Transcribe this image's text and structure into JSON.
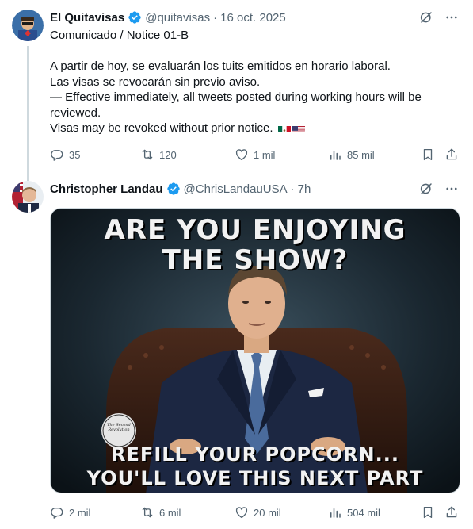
{
  "tweets": [
    {
      "author": {
        "name": "El Quitavisas",
        "handle": "@quitavisas",
        "verified": true
      },
      "date": "16 oct. 2025",
      "title": "Comunicado / Notice 01-B",
      "paragraph": [
        "A partir de hoy, se evaluarán los tuits emitidos en horario laboral.",
        "Las visas se revocarán sin previo aviso.",
        "— Effective immediately, all tweets posted during working hours will be",
        "reviewed.",
        "Visas may be revoked without prior notice."
      ],
      "flags": [
        "mexico-flag",
        "usa-flag"
      ],
      "stats": {
        "replies": "35",
        "reposts": "120",
        "likes": "1 mil",
        "views": "85 mil"
      }
    },
    {
      "author": {
        "name": "Christopher Landau",
        "handle": "@ChrisLandauUSA",
        "verified": true
      },
      "date": "7h",
      "media": {
        "top_line1": "ARE YOU ENJOYING",
        "top_line2": "THE SHOW?",
        "bottom_line1": "REFILL YOUR POPCORN...",
        "bottom_line2": "YOU'LL LOVE THIS NEXT PART",
        "watermark": "The Second Revolution"
      },
      "stats": {
        "replies": "2 mil",
        "reposts": "6 mil",
        "likes": "20 mil",
        "views": "504 mil"
      }
    }
  ],
  "colors": {
    "verified": "#1d9bf0",
    "muted": "#536471",
    "text": "#0f1419",
    "line": "#cfd9de"
  },
  "icons": [
    "verified-badge-icon",
    "grok-icon",
    "more-icon",
    "reply-icon",
    "repost-icon",
    "like-icon",
    "views-icon",
    "bookmark-icon",
    "share-icon"
  ]
}
